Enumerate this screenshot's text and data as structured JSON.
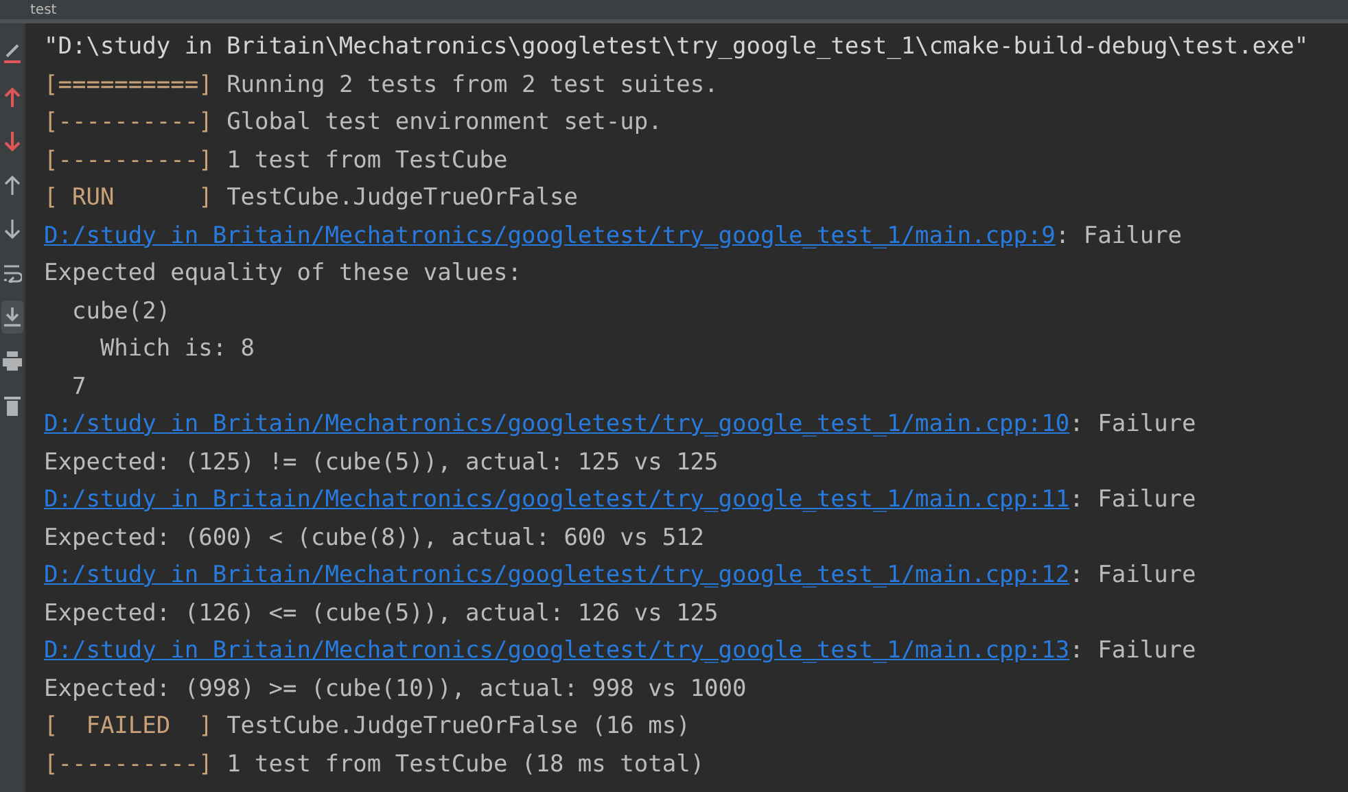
{
  "tab": {
    "label": "test"
  },
  "toolbar": [
    {
      "kind": "stop",
      "selected": false
    },
    {
      "kind": "up-red",
      "selected": false
    },
    {
      "kind": "down-red",
      "selected": false
    },
    {
      "kind": "up",
      "selected": false
    },
    {
      "kind": "down",
      "selected": false
    },
    {
      "kind": "wrap",
      "selected": false
    },
    {
      "kind": "download",
      "selected": true
    },
    {
      "kind": "print",
      "selected": false
    },
    {
      "kind": "trash",
      "selected": false
    }
  ],
  "lines": [
    {
      "kind": "command",
      "text": "\"D:\\study in Britain\\Mechatronics\\googletest\\try_google_test_1\\cmake-build-debug\\test.exe\""
    },
    {
      "kind": "status",
      "prefix": "[==========]",
      "text": " Running 2 tests from 2 test suites."
    },
    {
      "kind": "status",
      "prefix": "[----------]",
      "text": " Global test environment set-up."
    },
    {
      "kind": "status",
      "prefix": "[----------]",
      "text": " 1 test from TestCube"
    },
    {
      "kind": "status",
      "prefix": "[ RUN      ]",
      "text": " TestCube.JudgeTrueOrFalse"
    },
    {
      "kind": "link",
      "link": "D:/study in Britain/Mechatronics/googletest/try_google_test_1/main.cpp:9",
      "text": ": Failure"
    },
    {
      "kind": "plain",
      "text": "Expected equality of these values:"
    },
    {
      "kind": "plain",
      "text": "  cube(2)"
    },
    {
      "kind": "plain",
      "text": "    Which is: 8"
    },
    {
      "kind": "plain",
      "text": "  7"
    },
    {
      "kind": "link",
      "link": "D:/study in Britain/Mechatronics/googletest/try_google_test_1/main.cpp:10",
      "text": ": Failure"
    },
    {
      "kind": "plain",
      "text": "Expected: (125) != (cube(5)), actual: 125 vs 125"
    },
    {
      "kind": "link",
      "link": "D:/study in Britain/Mechatronics/googletest/try_google_test_1/main.cpp:11",
      "text": ": Failure"
    },
    {
      "kind": "plain",
      "text": "Expected: (600) < (cube(8)), actual: 600 vs 512"
    },
    {
      "kind": "link",
      "link": "D:/study in Britain/Mechatronics/googletest/try_google_test_1/main.cpp:12",
      "text": ": Failure"
    },
    {
      "kind": "plain",
      "text": "Expected: (126) <= (cube(5)), actual: 126 vs 125"
    },
    {
      "kind": "link",
      "link": "D:/study in Britain/Mechatronics/googletest/try_google_test_1/main.cpp:13",
      "text": ": Failure"
    },
    {
      "kind": "plain",
      "text": "Expected: (998) >= (cube(10)), actual: 998 vs 1000"
    },
    {
      "kind": "status",
      "prefix": "[  FAILED  ]",
      "text": " TestCube.JudgeTrueOrFalse (16 ms)"
    },
    {
      "kind": "status",
      "prefix": "[----------]",
      "text": " 1 test from TestCube (18 ms total)"
    }
  ]
}
